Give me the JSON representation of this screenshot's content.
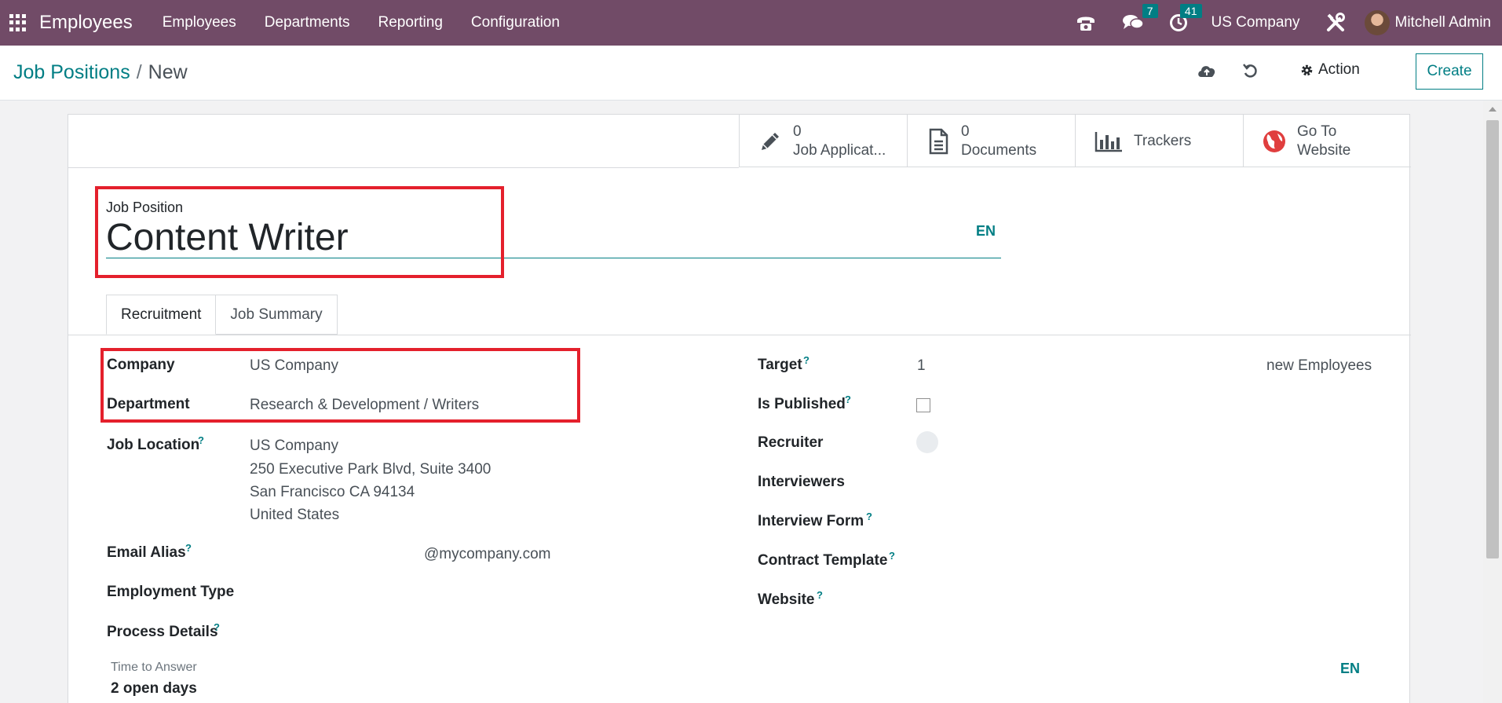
{
  "navbar": {
    "app_title": "Employees",
    "menu": [
      "Employees",
      "Departments",
      "Reporting",
      "Configuration"
    ],
    "messages_badge": "7",
    "activities_badge": "41",
    "company": "US Company",
    "user": "Mitchell Admin"
  },
  "breadcrumb": {
    "parent": "Job Positions",
    "separator": "/",
    "current": "New"
  },
  "control": {
    "action_label": "Action",
    "create_label": "Create"
  },
  "smart_buttons": [
    {
      "count": "0",
      "label": "Job Applicat..."
    },
    {
      "count": "0",
      "label": "Documents"
    },
    {
      "label": "Trackers"
    },
    {
      "line1": "Go To",
      "line2": "Website"
    }
  ],
  "form": {
    "job_position_label": "Job Position",
    "job_position_value": "Content Writer",
    "lang_tag": "EN",
    "tabs": [
      "Recruitment",
      "Job Summary"
    ],
    "left": {
      "company_label": "Company",
      "company_value": "US Company",
      "department_label": "Department",
      "department_value": "Research & Development / Writers",
      "job_location_label": "Job Location",
      "job_location_lines": [
        "US Company",
        "250 Executive Park Blvd, Suite 3400",
        "San Francisco CA 94134",
        "United States"
      ],
      "email_alias_label": "Email Alias",
      "email_alias_domain": "@mycompany.com",
      "employment_type_label": "Employment Type",
      "process_details_label": "Process Details",
      "time_to_answer_label": "Time to Answer",
      "time_to_answer_value": "2 open days",
      "bottom_lang_tag": "EN"
    },
    "right": {
      "target_label": "Target",
      "target_value": "1",
      "target_suffix": "new Employees",
      "is_published_label": "Is Published",
      "is_published": false,
      "recruiter_label": "Recruiter",
      "interviewers_label": "Interviewers",
      "interview_form_label": "Interview Form",
      "contract_template_label": "Contract Template",
      "website_label": "Website"
    },
    "help_mark": "?"
  },
  "colors": {
    "navbar": "#714b67",
    "accent": "#017e84",
    "highlight": "#e4202c"
  }
}
